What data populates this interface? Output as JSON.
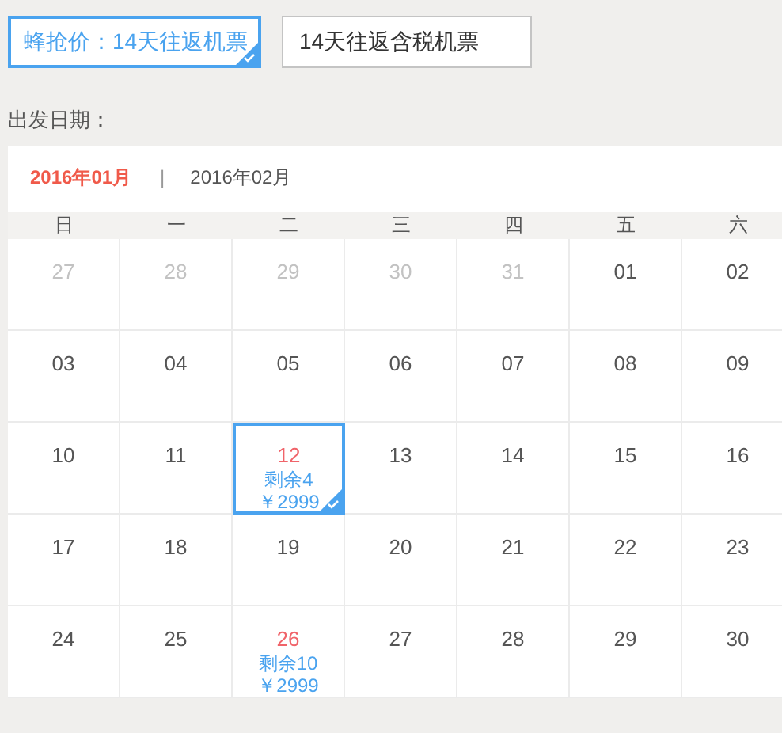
{
  "options": [
    {
      "label": "蜂抢价：14天往返机票",
      "selected": true
    },
    {
      "label": "14天往返含税机票",
      "selected": false
    }
  ],
  "date_label": "出发日期：",
  "calendar": {
    "months": [
      {
        "label": "2016年01月",
        "selected": true
      },
      {
        "label": "2016年02月",
        "selected": false
      }
    ],
    "separator": "|",
    "weekdays": [
      "日",
      "一",
      "二",
      "三",
      "四",
      "五",
      "六"
    ],
    "days": [
      {
        "date": "27",
        "in_month": false,
        "selected": false
      },
      {
        "date": "28",
        "in_month": false,
        "selected": false
      },
      {
        "date": "29",
        "in_month": false,
        "selected": false
      },
      {
        "date": "30",
        "in_month": false,
        "selected": false
      },
      {
        "date": "31",
        "in_month": false,
        "selected": false
      },
      {
        "date": "01",
        "in_month": true,
        "selected": false
      },
      {
        "date": "02",
        "in_month": true,
        "selected": false
      },
      {
        "date": "03",
        "in_month": true,
        "selected": false
      },
      {
        "date": "04",
        "in_month": true,
        "selected": false
      },
      {
        "date": "05",
        "in_month": true,
        "selected": false
      },
      {
        "date": "06",
        "in_month": true,
        "selected": false
      },
      {
        "date": "07",
        "in_month": true,
        "selected": false
      },
      {
        "date": "08",
        "in_month": true,
        "selected": false
      },
      {
        "date": "09",
        "in_month": true,
        "selected": false
      },
      {
        "date": "10",
        "in_month": true,
        "selected": false
      },
      {
        "date": "11",
        "in_month": true,
        "selected": false
      },
      {
        "date": "12",
        "in_month": true,
        "selected": true,
        "remaining": "剩余4",
        "price": "￥2999"
      },
      {
        "date": "13",
        "in_month": true,
        "selected": false
      },
      {
        "date": "14",
        "in_month": true,
        "selected": false
      },
      {
        "date": "15",
        "in_month": true,
        "selected": false
      },
      {
        "date": "16",
        "in_month": true,
        "selected": false
      },
      {
        "date": "17",
        "in_month": true,
        "selected": false
      },
      {
        "date": "18",
        "in_month": true,
        "selected": false
      },
      {
        "date": "19",
        "in_month": true,
        "selected": false
      },
      {
        "date": "20",
        "in_month": true,
        "selected": false
      },
      {
        "date": "21",
        "in_month": true,
        "selected": false
      },
      {
        "date": "22",
        "in_month": true,
        "selected": false
      },
      {
        "date": "23",
        "in_month": true,
        "selected": false
      },
      {
        "date": "24",
        "in_month": true,
        "selected": false
      },
      {
        "date": "25",
        "in_month": true,
        "selected": false
      },
      {
        "date": "26",
        "in_month": true,
        "selected": false,
        "remaining": "剩余10",
        "price": "￥2999"
      },
      {
        "date": "27",
        "in_month": true,
        "selected": false
      },
      {
        "date": "28",
        "in_month": true,
        "selected": false
      },
      {
        "date": "29",
        "in_month": true,
        "selected": false
      },
      {
        "date": "30",
        "in_month": true,
        "selected": false
      }
    ]
  }
}
